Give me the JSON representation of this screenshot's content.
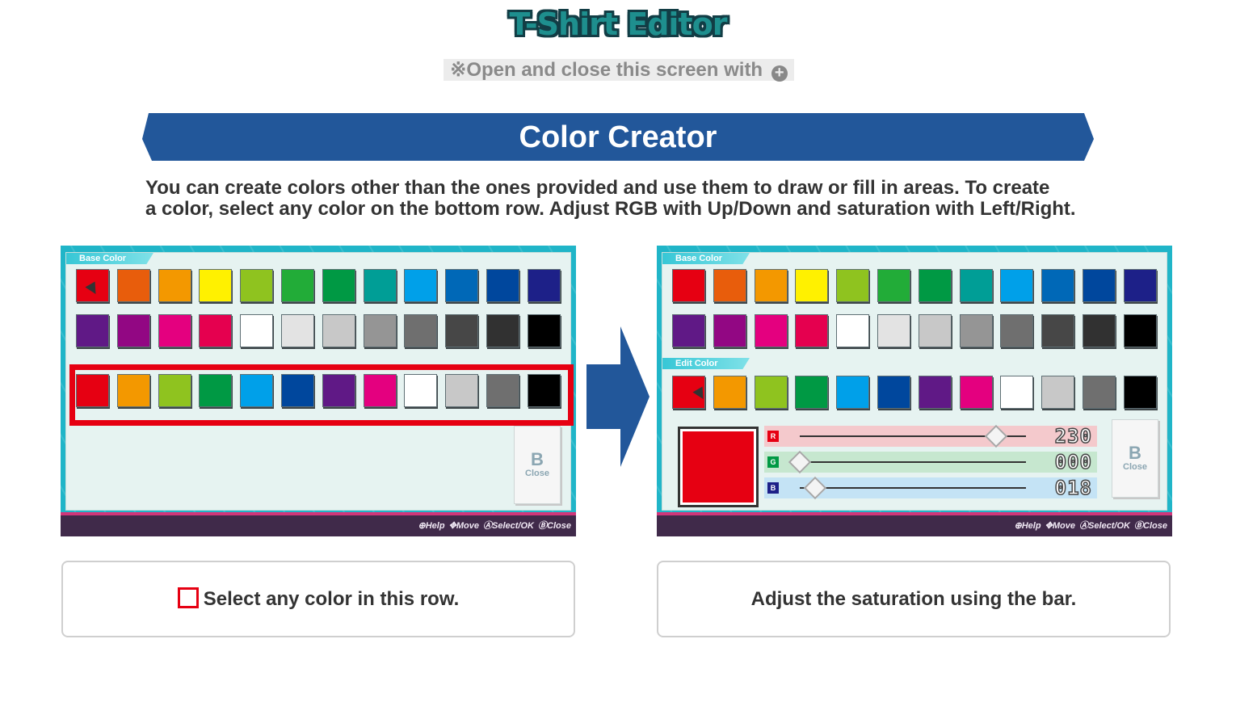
{
  "header": {
    "title": "T-Shirt Editor",
    "note": "※Open and close this screen with",
    "note_icon": "plus-button-icon"
  },
  "section": {
    "title": "Color Creator",
    "description_line1": "You can create colors other than the ones provided and use them to draw or fill in areas. To create",
    "description_line2": "a color, select any color on the bottom row. Adjust RGB with Up/Down and saturation with Left/Right."
  },
  "palette": {
    "base_row1": [
      "#e60012",
      "#e85d0c",
      "#f39800",
      "#fff100",
      "#8fc31f",
      "#22ac38",
      "#009944",
      "#009e96",
      "#00a0e9",
      "#0068b7",
      "#00479d",
      "#1d2088"
    ],
    "base_row2": [
      "#601986",
      "#920783",
      "#e4007f",
      "#e5004f",
      "#ffffff",
      "#e3e3e3",
      "#c8c8c8",
      "#959595",
      "#6f6f6f",
      "#474747",
      "#313131",
      "#000000"
    ],
    "edit_row": [
      "#e60012",
      "#f39800",
      "#8fc31f",
      "#009944",
      "#00a0e9",
      "#00479d",
      "#601986",
      "#e4007f",
      "#ffffff",
      "#c8c8c8",
      "#6f6f6f",
      "#000000"
    ]
  },
  "screen_left": {
    "base_label": "Base Color",
    "close_key": "B",
    "close_label": "Close",
    "statusbar": "⊕Help  ✥Move  ⒶSelect/OK  ⒷClose"
  },
  "screen_right": {
    "base_label": "Base Color",
    "edit_label": "Edit Color",
    "close_key": "B",
    "close_label": "Close",
    "statusbar": "⊕Help  ✥Move  ⒶSelect/OK  ⒷClose",
    "preview_color": "#e60012",
    "sliders": [
      {
        "letter": "R",
        "value": "230",
        "level": 0.9,
        "row_color": "#f4c9cc",
        "letter_color": "#e60012"
      },
      {
        "letter": "G",
        "value": "000",
        "level": 0.0,
        "row_color": "#c6e7cf",
        "letter_color": "#009944"
      },
      {
        "letter": "B",
        "value": "018",
        "level": 0.07,
        "row_color": "#c4e3f5",
        "letter_color": "#1d2088"
      }
    ]
  },
  "captions": {
    "left": "Select any color in this row.",
    "right": "Adjust the saturation using the bar."
  }
}
